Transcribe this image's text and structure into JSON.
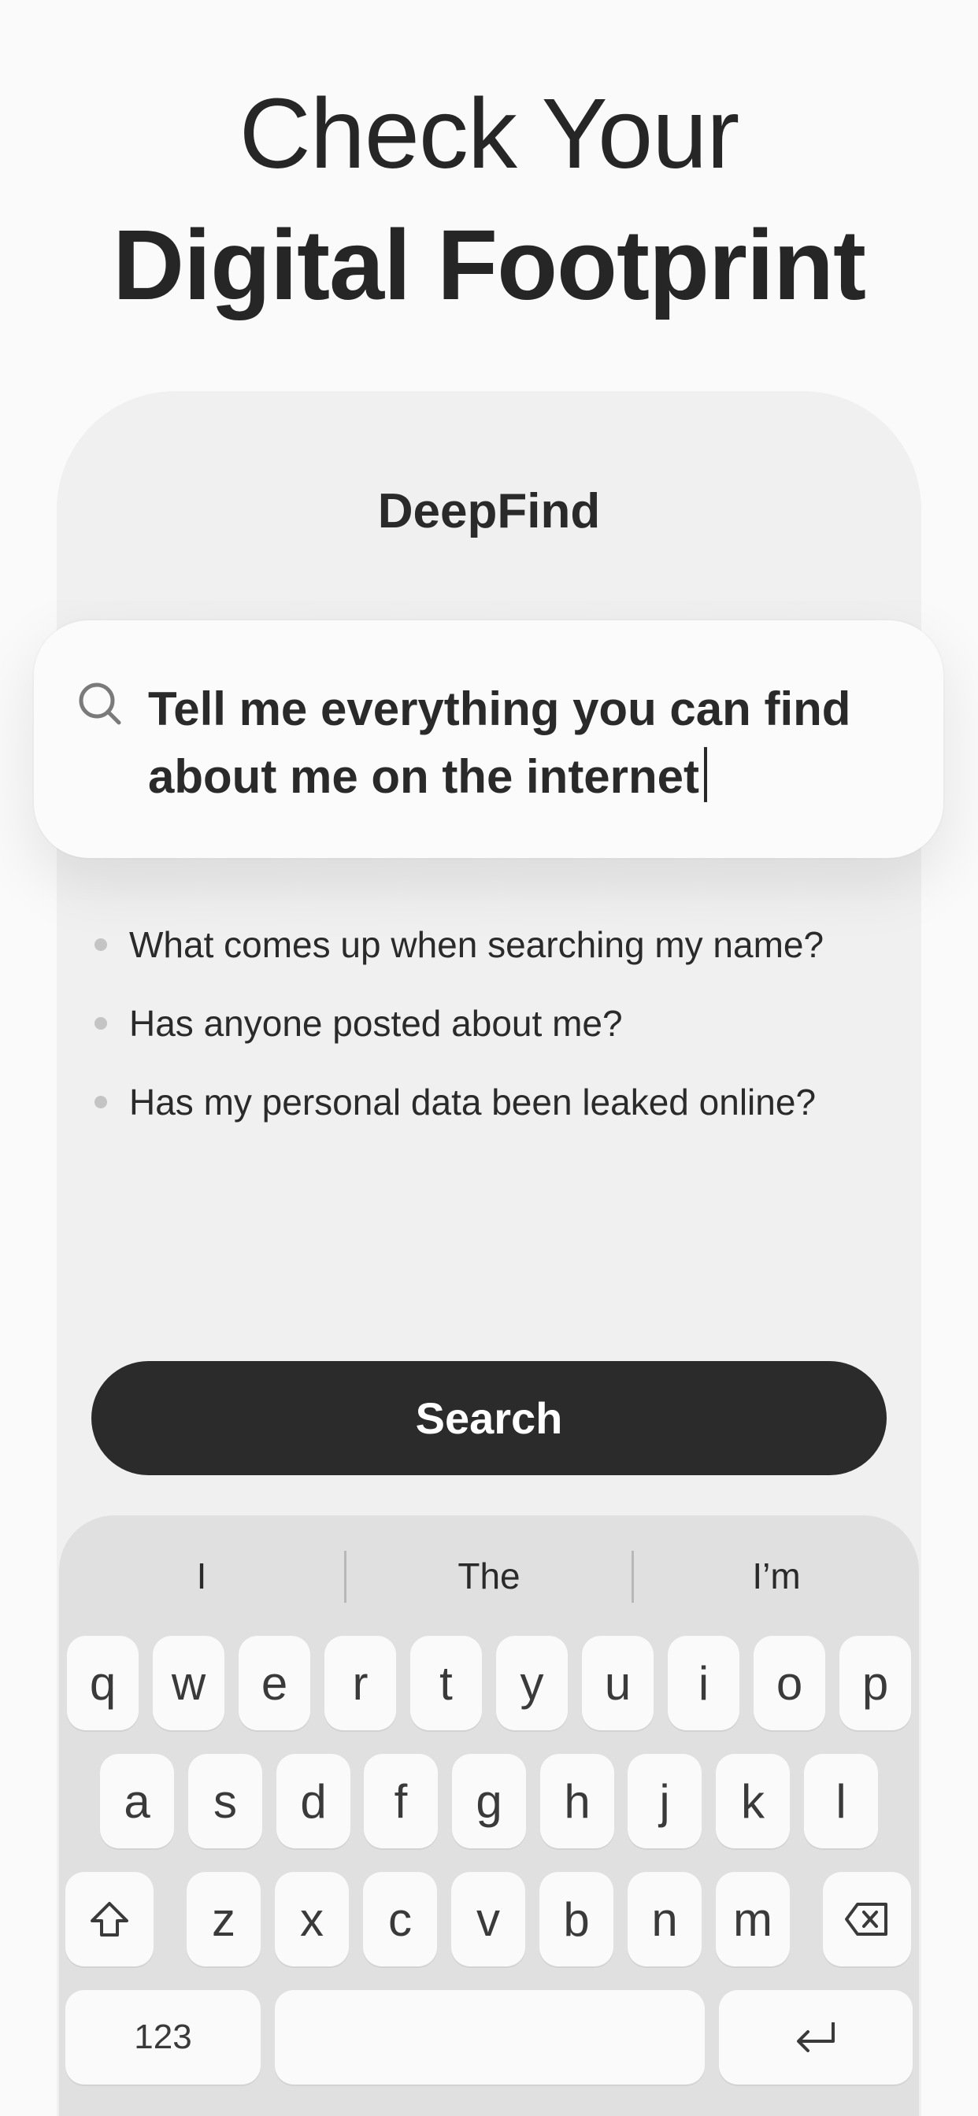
{
  "hero": {
    "line1": "Check Your",
    "line2": "Digital Footprint"
  },
  "app": {
    "name": "DeepFind"
  },
  "search": {
    "icon": "search-icon",
    "query": "Tell me everything you can find\nabout me on the internet"
  },
  "suggestions": [
    "What comes up when searching my name?",
    "Has anyone posted about me?",
    "Has my personal data been leaked online?"
  ],
  "search_button": {
    "label": "Search"
  },
  "keyboard": {
    "predictions": [
      "I",
      "The",
      "I’m"
    ],
    "row1": [
      "q",
      "w",
      "e",
      "r",
      "t",
      "y",
      "u",
      "i",
      "o",
      "p"
    ],
    "row2": [
      "a",
      "s",
      "d",
      "f",
      "g",
      "h",
      "j",
      "k",
      "l"
    ],
    "row3": [
      "z",
      "x",
      "c",
      "v",
      "b",
      "n",
      "m"
    ],
    "numbers_label": "123",
    "shift_icon": "shift-icon",
    "delete_icon": "backspace-icon",
    "return_icon": "return-icon"
  },
  "colors": {
    "background": "#fafafa",
    "card": "#f0f0f0",
    "button": "#2b2b2b",
    "keyboard": "#e0e0e0",
    "text": "#2a2a2a"
  }
}
